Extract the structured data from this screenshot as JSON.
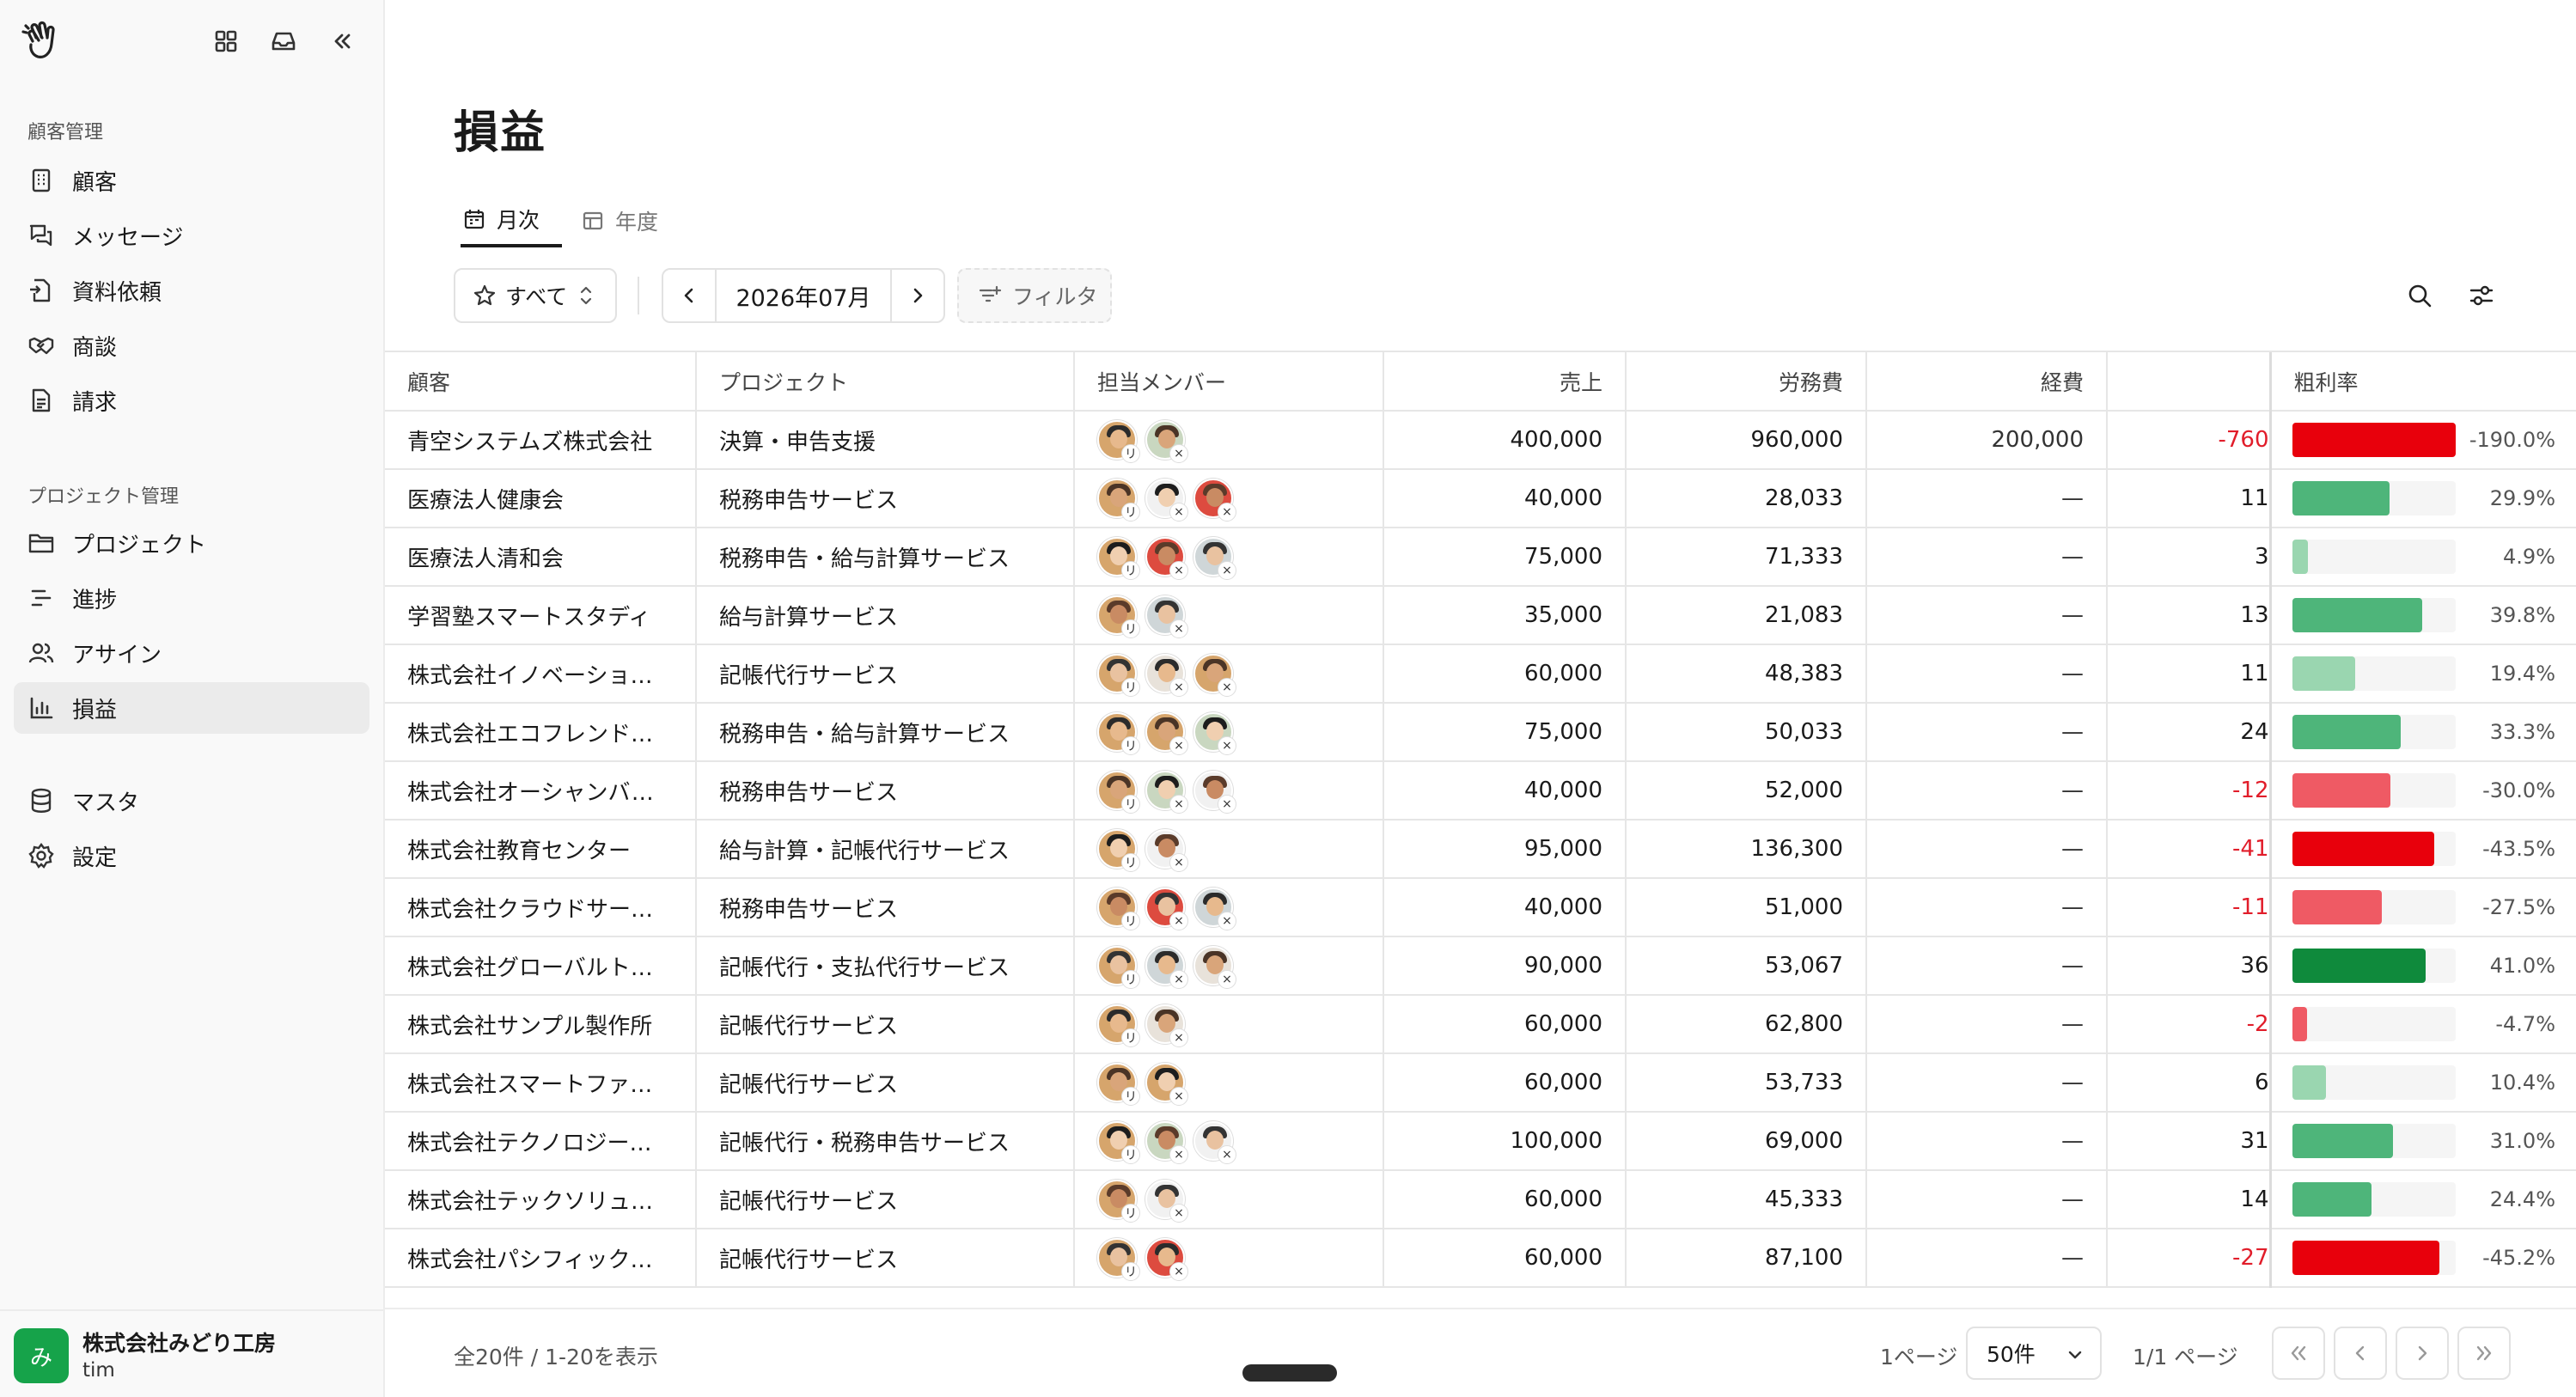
{
  "sidebar": {
    "section_customer": "顧客管理",
    "section_project": "プロジェクト管理",
    "items": [
      {
        "label": "顧客",
        "icon": "building-icon"
      },
      {
        "label": "メッセージ",
        "icon": "messages-icon"
      },
      {
        "label": "資料依頼",
        "icon": "document-request-icon"
      },
      {
        "label": "商談",
        "icon": "handshake-icon"
      },
      {
        "label": "請求",
        "icon": "invoice-icon"
      },
      {
        "label": "プロジェクト",
        "icon": "folder-icon"
      },
      {
        "label": "進捗",
        "icon": "progress-list-icon"
      },
      {
        "label": "アサイン",
        "icon": "users-icon"
      },
      {
        "label": "損益",
        "icon": "bar-chart-icon"
      },
      {
        "label": "マスタ",
        "icon": "database-icon"
      },
      {
        "label": "設定",
        "icon": "gear-icon"
      }
    ],
    "org_initial": "み",
    "org_name": "株式会社みどり工房",
    "user_name": "tim"
  },
  "page": {
    "title": "損益",
    "tabs": [
      {
        "label": "月次"
      },
      {
        "label": "年度"
      }
    ],
    "scope_select": "すべて",
    "month": "2026年07月",
    "filter_label": "フィルタ"
  },
  "table": {
    "columns": [
      "顧客",
      "プロジェクト",
      "担当メンバー",
      "売上",
      "労務費",
      "経費",
      "",
      "粗利率"
    ],
    "rows": [
      {
        "customer": "青空システムズ株式会社",
        "project": "決算・申告支援",
        "members": [
          "リ",
          "×"
        ],
        "sales": "400,000",
        "labor": "960,000",
        "expense": "200,000",
        "profit": "-760",
        "margin": "-190.0%",
        "margin_value": -190.0
      },
      {
        "customer": "医療法人健康会",
        "project": "税務申告サービス",
        "members": [
          "リ",
          "×",
          "×"
        ],
        "sales": "40,000",
        "labor": "28,033",
        "expense": "—",
        "profit": "11",
        "margin": "29.9%",
        "margin_value": 29.9
      },
      {
        "customer": "医療法人清和会",
        "project": "税務申告・給与計算サービス",
        "members": [
          "リ",
          "×",
          "×"
        ],
        "sales": "75,000",
        "labor": "71,333",
        "expense": "—",
        "profit": "3",
        "margin": "4.9%",
        "margin_value": 4.9
      },
      {
        "customer": "学習塾スマートスタディ",
        "project": "給与計算サービス",
        "members": [
          "リ",
          "×"
        ],
        "sales": "35,000",
        "labor": "21,083",
        "expense": "—",
        "profit": "13",
        "margin": "39.8%",
        "margin_value": 39.8
      },
      {
        "customer": "株式会社イノベーション…",
        "project": "記帳代行サービス",
        "members": [
          "リ",
          "×",
          "×"
        ],
        "sales": "60,000",
        "labor": "48,383",
        "expense": "—",
        "profit": "11",
        "margin": "19.4%",
        "margin_value": 19.4
      },
      {
        "customer": "株式会社エコフレンドリ…",
        "project": "税務申告・給与計算サービス",
        "members": [
          "リ",
          "×",
          "×"
        ],
        "sales": "75,000",
        "labor": "50,033",
        "expense": "—",
        "profit": "24",
        "margin": "33.3%",
        "margin_value": 33.3
      },
      {
        "customer": "株式会社オーシャンバン…",
        "project": "税務申告サービス",
        "members": [
          "リ",
          "×",
          "×"
        ],
        "sales": "40,000",
        "labor": "52,000",
        "expense": "—",
        "profit": "-12",
        "margin": "-30.0%",
        "margin_value": -30.0
      },
      {
        "customer": "株式会社教育センター",
        "project": "給与計算・記帳代行サービス",
        "members": [
          "リ",
          "×"
        ],
        "sales": "95,000",
        "labor": "136,300",
        "expense": "—",
        "profit": "-41",
        "margin": "-43.5%",
        "margin_value": -43.5
      },
      {
        "customer": "株式会社クラウドサービ…",
        "project": "税務申告サービス",
        "members": [
          "リ",
          "×",
          "×"
        ],
        "sales": "40,000",
        "labor": "51,000",
        "expense": "—",
        "profit": "-11",
        "margin": "-27.5%",
        "margin_value": -27.5
      },
      {
        "customer": "株式会社グローバルトレ…",
        "project": "記帳代行・支払代行サービス",
        "members": [
          "リ",
          "×",
          "×"
        ],
        "sales": "90,000",
        "labor": "53,067",
        "expense": "—",
        "profit": "36",
        "margin": "41.0%",
        "margin_value": 41.0
      },
      {
        "customer": "株式会社サンプル製作所",
        "project": "記帳代行サービス",
        "members": [
          "リ",
          "×"
        ],
        "sales": "60,000",
        "labor": "62,800",
        "expense": "—",
        "profit": "-2",
        "margin": "-4.7%",
        "margin_value": -4.7
      },
      {
        "customer": "株式会社スマートファー…",
        "project": "記帳代行サービス",
        "members": [
          "リ",
          "×"
        ],
        "sales": "60,000",
        "labor": "53,733",
        "expense": "—",
        "profit": "6",
        "margin": "10.4%",
        "margin_value": 10.4
      },
      {
        "customer": "株式会社テクノロジーコ…",
        "project": "記帳代行・税務申告サービス",
        "members": [
          "リ",
          "×",
          "×"
        ],
        "sales": "100,000",
        "labor": "69,000",
        "expense": "—",
        "profit": "31",
        "margin": "31.0%",
        "margin_value": 31.0
      },
      {
        "customer": "株式会社テックソリュー…",
        "project": "記帳代行サービス",
        "members": [
          "リ",
          "×"
        ],
        "sales": "60,000",
        "labor": "45,333",
        "expense": "—",
        "profit": "14",
        "margin": "24.4%",
        "margin_value": 24.4
      },
      {
        "customer": "株式会社パシフィック建…",
        "project": "記帳代行サービス",
        "members": [
          "リ",
          "×"
        ],
        "sales": "60,000",
        "labor": "87,100",
        "expense": "—",
        "profit": "-27",
        "margin": "-45.2%",
        "margin_value": -45.2
      }
    ]
  },
  "footer": {
    "count": "全20件 / 1-20を表示",
    "page_label": "1ページ",
    "page_size": "50件",
    "page_info": "1/1 ページ"
  },
  "colors": {
    "negative": "#e11d2a",
    "negative_strong": "#e8000c",
    "negative_light": "#ef5a64",
    "positive_strong": "#0f8a3c",
    "positive": "#4eb57a",
    "positive_light": "#9ad6b0",
    "org_avatar": "#16a34a"
  }
}
